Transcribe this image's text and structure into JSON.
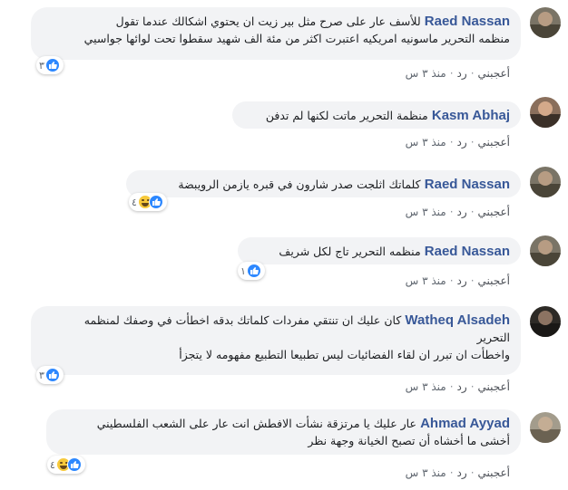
{
  "comments": [
    {
      "author": "Raed Nassan",
      "lines": [
        "للأسف عار على صرح مثل بير زيت ان يحتوي اشكالك عندما تقول",
        "منظمه التحرير ماسونيه امريكيه اعتبرت اكثر من مئة الف شهيد سقطوا تحت لوائها جواسيي"
      ],
      "reaction_count": "٣",
      "reactions": [
        "like-icon"
      ],
      "like_label": "أعجبني",
      "reply_label": "رد",
      "time": "منذ ٣ س"
    },
    {
      "author": "Kasm Abhaj",
      "lines": [
        "منظمة التحرير ماتت لكنها لم تدفن"
      ],
      "reaction_count": "",
      "reactions": [],
      "like_label": "أعجبني",
      "reply_label": "رد",
      "time": "منذ ٣ س"
    },
    {
      "author": "Raed Nassan",
      "lines": [
        "كلماتك اثلجت صدر شارون في قبره يازمن الرويبضة"
      ],
      "reaction_count": "٤",
      "reactions": [
        "like-icon",
        "haha-icon"
      ],
      "like_label": "أعجبني",
      "reply_label": "رد",
      "time": "منذ ٣ س"
    },
    {
      "author": "Raed Nassan",
      "lines": [
        "منظمه التحرير تاج لكل شريف"
      ],
      "reaction_count": "١",
      "reactions": [
        "like-icon"
      ],
      "like_label": "أعجبني",
      "reply_label": "رد",
      "time": "منذ ٣ س"
    },
    {
      "author": "Watheq Alsadeh",
      "lines": [
        "كان عليك ان تنتقي مفردات كلماتك بدقه اخطأت في وصفك لمنظمه",
        "التحرير",
        "واخطأت ان تبرر ان لقاء الفضائيات ليس تطبيعا التطبيع مفهومه لا يتجزأ"
      ],
      "reaction_count": "٣",
      "reactions": [
        "like-icon"
      ],
      "like_label": "أعجبني",
      "reply_label": "رد",
      "time": "منذ ٣ س"
    },
    {
      "author": "Ahmad Ayyad",
      "lines": [
        "عار عليك يا مرتزقة نشأت الافطش انت عار على الشعب الفلسطيني",
        "أخشى ما أخشاه أن تصبح الخيانة وجهة نظر"
      ],
      "reaction_count": "٤",
      "reactions": [
        "like-icon",
        "haha-icon"
      ],
      "like_label": "أعجبني",
      "reply_label": "رد",
      "time": "منذ ٣ س"
    }
  ],
  "colors": {
    "name": "#385898",
    "bubble": "#f2f3f5",
    "like": "#2d88ff",
    "haha": "#f7c93b"
  }
}
